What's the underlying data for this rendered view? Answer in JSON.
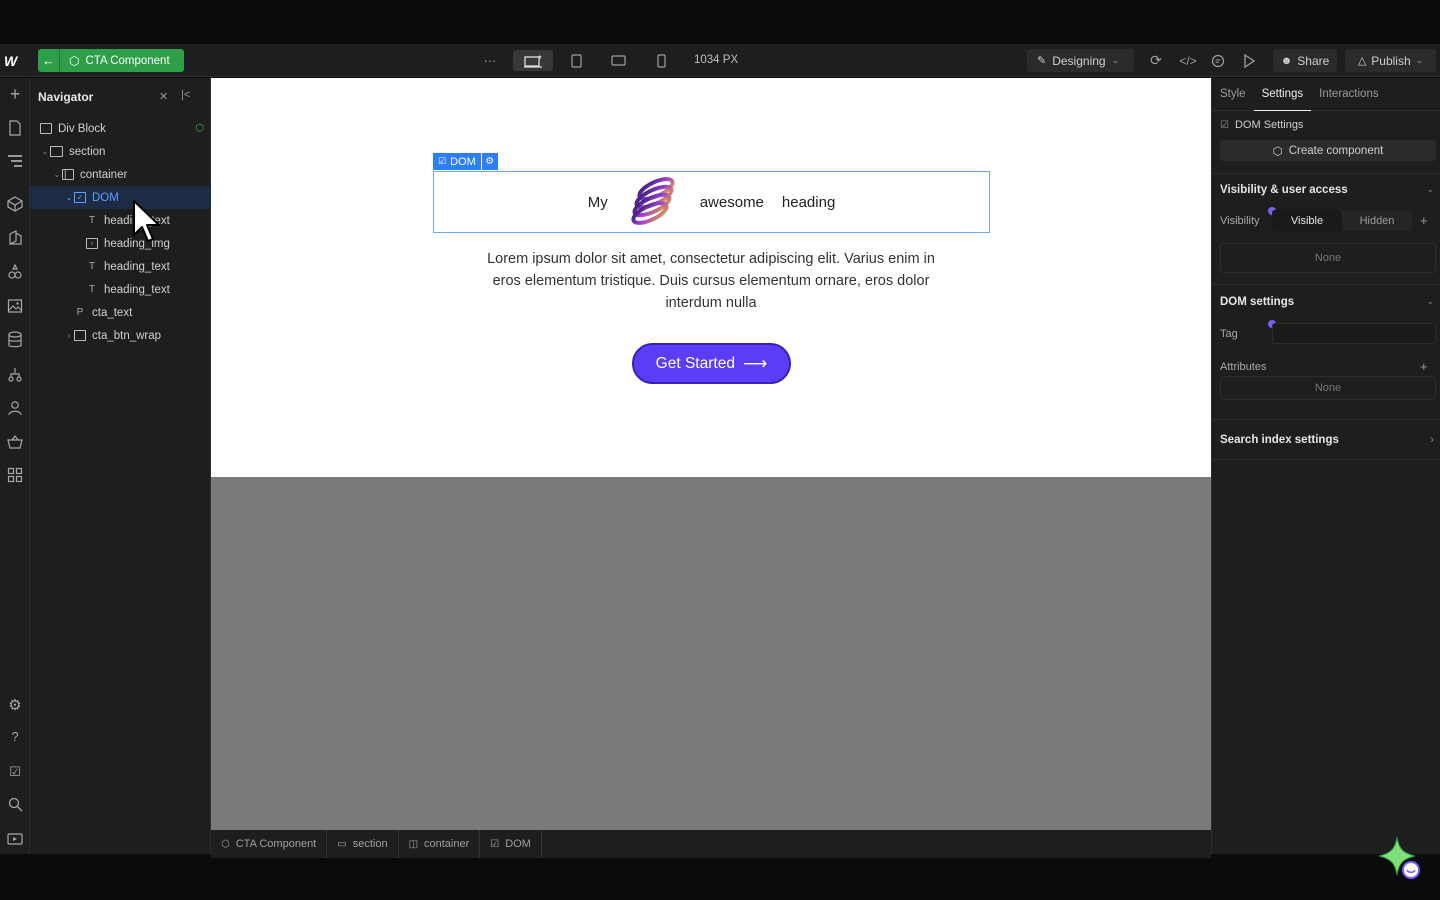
{
  "toolbar": {
    "logo": "W",
    "component_label": "CTA Component",
    "more": "···",
    "width_readout": "1034 PX",
    "mode_label": "Designing",
    "share_label": "Share",
    "publish_label": "Publish"
  },
  "navigator": {
    "title": "Navigator",
    "items": [
      {
        "label": "Div Block"
      },
      {
        "label": "section"
      },
      {
        "label": "container"
      },
      {
        "label": "DOM"
      },
      {
        "label": "heading_text",
        "glyph": "T"
      },
      {
        "label": "heading_img"
      },
      {
        "label": "heading_text",
        "glyph": "T"
      },
      {
        "label": "heading_text",
        "glyph": "T"
      },
      {
        "label": "cta_text",
        "glyph": "P"
      },
      {
        "label": "cta_btn_wrap"
      }
    ]
  },
  "canvas": {
    "dom_tag": "DOM",
    "heading_words": [
      "My",
      "awesome",
      "heading"
    ],
    "cta_text": "Lorem ipsum dolor sit amet, consectetur adipiscing elit. Varius enim in eros elementum tristique. Duis cursus elementum ornare, eros dolor interdum nulla",
    "cta_button": "Get Started",
    "button_color": "#5b3df5"
  },
  "breadcrumbs": [
    "CTA Component",
    "section",
    "container",
    "DOM"
  ],
  "right_panel": {
    "tabs": [
      "Style",
      "Settings",
      "Interactions"
    ],
    "dom_settings_label": "DOM Settings",
    "create_component": "Create component",
    "visibility_section": "Visibility & user access",
    "visibility_label": "Visibility",
    "visible": "Visible",
    "hidden": "Hidden",
    "visibility_none": "None",
    "dom_settings_section": "DOM settings",
    "tag_label": "Tag",
    "attributes_label": "Attributes",
    "attributes_none": "None",
    "search_index": "Search index settings"
  },
  "colors": {
    "accent_green": "#2f9e49",
    "selection_blue": "#2d7ff9",
    "purple": "#7a5cff"
  }
}
